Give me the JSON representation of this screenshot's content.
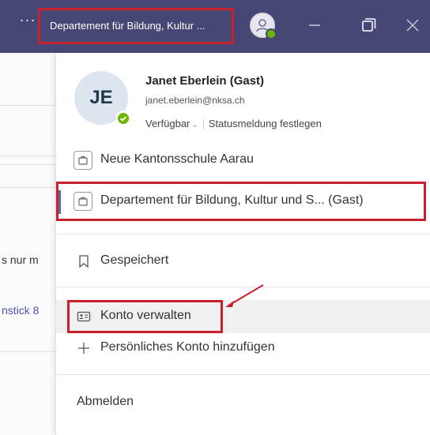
{
  "titlebar": {
    "more_label": "···",
    "tenant_label": "Departement für Bildung, Kultur ...",
    "avatar_icon": "person-icon",
    "minimize_icon": "minimize-icon",
    "maximize_icon": "maximize-icon",
    "close_icon": "close-icon"
  },
  "background": {
    "snippet_1": "s nur m",
    "snippet_2": "nstick 8"
  },
  "profile": {
    "initials": "JE",
    "name": "Janet Eberlein (Gast)",
    "email": "janet.eberlein@nksa.ch",
    "status": "Verfügbar",
    "status_message": "Statusmeldung festlegen"
  },
  "organizations": [
    {
      "label": "Neue Kantonsschule Aarau",
      "icon": "organization-icon"
    },
    {
      "label": "Departement für Bildung, Kultur und S...  (Gast)",
      "icon": "organization-icon",
      "active": true
    }
  ],
  "menu": {
    "saved": {
      "label": "Gespeichert",
      "icon": "bookmark-icon"
    },
    "manage_account": {
      "label": "Konto verwalten",
      "icon": "contact-card-icon"
    },
    "add_personal_account": {
      "label": "Persönliches Konto hinzufügen",
      "icon": "plus-icon"
    },
    "sign_out": {
      "label": "Abmelden"
    }
  },
  "colors": {
    "titlebar": "#464775",
    "highlight": "#c8202c",
    "available": "#6bb700",
    "accent": "#6264a7"
  }
}
